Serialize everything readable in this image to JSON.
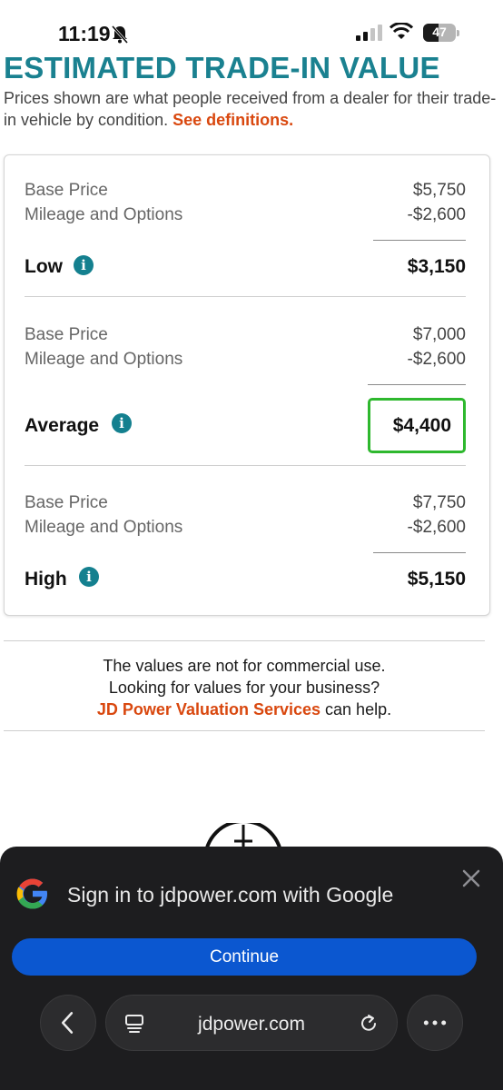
{
  "status_bar": {
    "time": "11:19",
    "battery": "47"
  },
  "page": {
    "title": "ESTIMATED TRADE-IN VALUE",
    "intro": "Prices shown are what people received from a dealer for their trade-in vehicle by condition. ",
    "intro_link": "See definitions."
  },
  "conditions": [
    {
      "base_label": "Base Price",
      "base_value": "$5,750",
      "adj_label": "Mileage and Options",
      "adj_value": "-$2,600",
      "label": "Low",
      "total": "$3,150"
    },
    {
      "base_label": "Base Price",
      "base_value": "$7,000",
      "adj_label": "Mileage and Options",
      "adj_value": "-$2,600",
      "label": "Average",
      "total": "$4,400"
    },
    {
      "base_label": "Base Price",
      "base_value": "$7,750",
      "adj_label": "Mileage and Options",
      "adj_value": "-$2,600",
      "label": "High",
      "total": "$5,150"
    }
  ],
  "disclaimer": {
    "line1": "The values are not for commercial use.",
    "line2": "Looking for values for your business?",
    "link": "JD Power Valuation Services",
    "line3_suffix": " can help."
  },
  "signin_sheet": {
    "title": "Sign in to jdpower.com with Google",
    "continue_label": "Continue"
  },
  "browser": {
    "url": "jdpower.com"
  },
  "colors": {
    "teal": "#1a8190",
    "orange_link": "#d9480f",
    "highlight_green": "#2eb82e",
    "google_blue": "#0b57d0"
  }
}
